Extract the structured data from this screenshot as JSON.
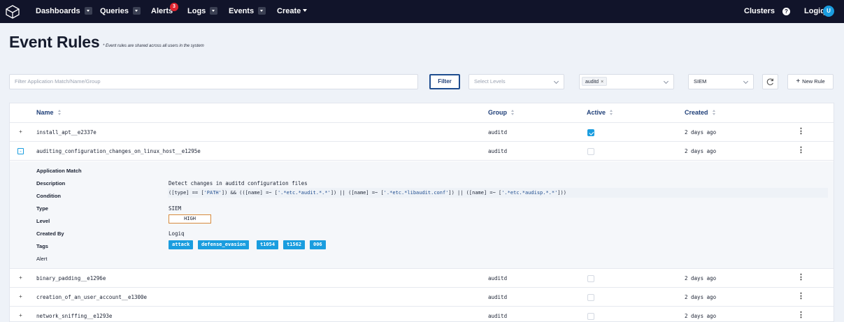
{
  "nav": {
    "items": [
      "Dashboards",
      "Queries",
      "Alerts",
      "Logs",
      "Events",
      "Create"
    ],
    "alerts_badge": "3",
    "clusters": "Clusters",
    "help": "?",
    "user": "Logiq",
    "avatar": "U"
  },
  "header": {
    "title": "Event Rules",
    "note": "* Event rules are shared across all users in the system"
  },
  "toolbar": {
    "search_placeholder": "Filter Application Match/Name/Group",
    "filter_label": "Filter",
    "levels_placeholder": "Select Levels",
    "group_chip": "auditd",
    "group_chip_remove": "×",
    "type_value": "SIEM",
    "new_rule_label": "New Rule"
  },
  "table": {
    "columns": [
      "Name",
      "Group",
      "Active",
      "Created"
    ],
    "rows": [
      {
        "name": "install_apt__e2337e",
        "group": "auditd",
        "active": true,
        "created": "2 days ago",
        "expander": "+"
      },
      {
        "name": "auditing_configuration_changes_on_linux_host__e1295e",
        "group": "auditd",
        "active": false,
        "created": "2 days ago",
        "expander": "-"
      }
    ],
    "rows_after": [
      {
        "name": "binary_padding__e1296e",
        "group": "auditd",
        "active": false,
        "created": "2 days ago",
        "expander": "+"
      },
      {
        "name": "creation_of_an_user_account__e1300e",
        "group": "auditd",
        "active": false,
        "created": "2 days ago",
        "expander": "+"
      },
      {
        "name": "network_sniffing__e1293e",
        "group": "auditd",
        "active": false,
        "created": "2 days ago",
        "expander": "+"
      }
    ]
  },
  "detail": {
    "labels": {
      "application_match": "Application Match",
      "description": "Description",
      "condition": "Condition",
      "type": "Type",
      "level": "Level",
      "created_by": "Created By",
      "tags": "Tags",
      "alert": "Alert"
    },
    "description": "Detect changes in auditd configuration files",
    "condition": {
      "p1": "([type] == [",
      "s1": "'PATH'",
      "p2": "]) && (([name] =~ [",
      "s2": "'.*etc.*audit.*.*'",
      "p3": "]) || ([name] =~ [",
      "s3": "'.*etc.*libaudit.conf'",
      "p4": "]) || ([name] =~ [",
      "s4": "'.*etc.*audisp.*.*'",
      "p5": "]))"
    },
    "type": "SIEM",
    "level": "HIGH",
    "created_by": "Logiq",
    "tags": [
      "attack",
      "defense_evasion",
      "t1054",
      "t1562",
      "006"
    ]
  },
  "icons": [
    "logo-cube-icon",
    "refresh-icon",
    "plus-icon",
    "kebab-menu-icon",
    "sort-icon",
    "chevron-down-icon",
    "help-icon"
  ]
}
